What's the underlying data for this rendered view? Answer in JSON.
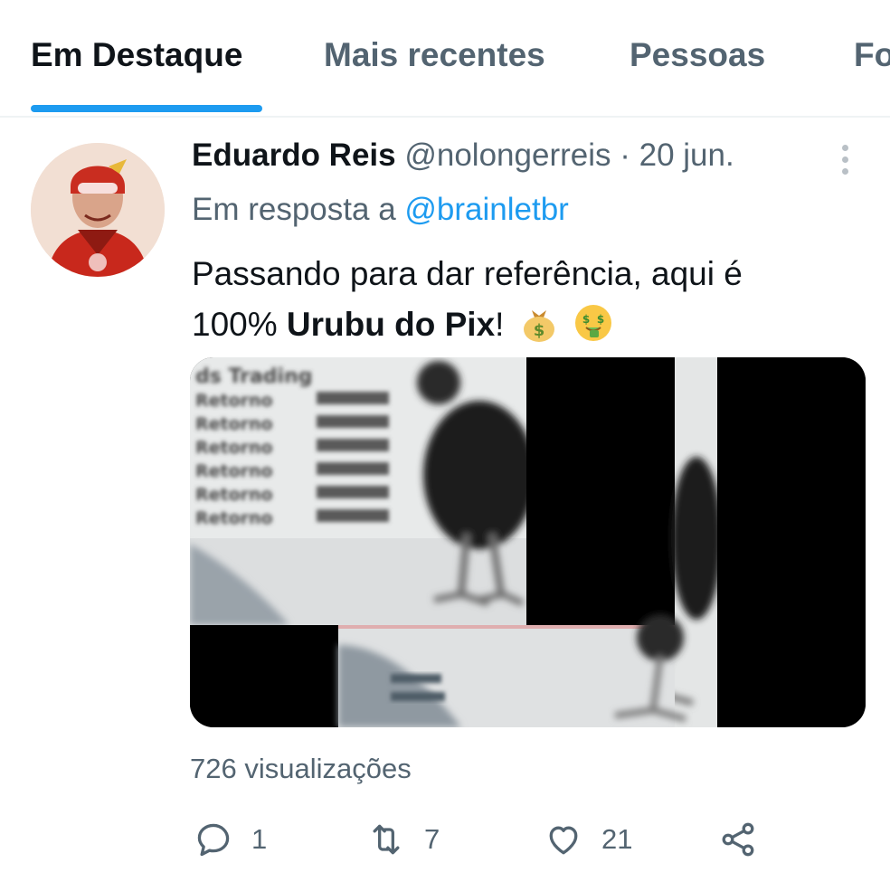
{
  "tabs": [
    {
      "label": "Em Destaque",
      "active": true
    },
    {
      "label": "Mais recentes",
      "active": false
    },
    {
      "label": "Pessoas",
      "active": false
    },
    {
      "label": "Fo",
      "active": false
    }
  ],
  "tweet": {
    "author_name": "Eduardo Reis",
    "author_handle": "@nolongerreis",
    "separator": "·",
    "date": "20 jun.",
    "reply_prefix": "Em resposta a",
    "reply_to": "@brainletbr",
    "text_line1": "Passando para dar referência, aqui é",
    "text_line2_before": "100% ",
    "text_line2_bold": "Urubu do Pix",
    "text_line2_after": "!",
    "emojis": [
      "money-bag-icon",
      "money-mouth-face-icon"
    ],
    "media_text_lines": [
      "ds Trading",
      "Retorno",
      "Retorno",
      "Retorno",
      "Retorno",
      "Retorno",
      "Retorno"
    ],
    "views": "726 visualizações",
    "actions": {
      "replies": "1",
      "retweets": "7",
      "likes": "21"
    }
  },
  "colors": {
    "accent": "#1d9bf0",
    "text": "#0f1419",
    "secondary": "#536471",
    "divider": "#eff3f4"
  }
}
